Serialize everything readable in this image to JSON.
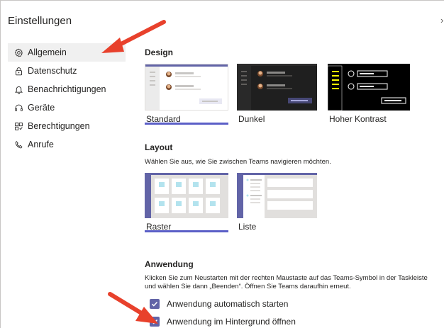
{
  "window": {
    "title": "Einstellungen",
    "close_glyph": "›"
  },
  "sidebar": {
    "items": [
      {
        "label": "Allgemein",
        "icon": "gear-icon",
        "active": true
      },
      {
        "label": "Datenschutz",
        "icon": "lock-icon",
        "active": false
      },
      {
        "label": "Benachrichtigungen",
        "icon": "bell-icon",
        "active": false
      },
      {
        "label": "Geräte",
        "icon": "headset-icon",
        "active": false
      },
      {
        "label": "Berechtigungen",
        "icon": "permissions-icon",
        "active": false
      },
      {
        "label": "Anrufe",
        "icon": "phone-icon",
        "active": false
      }
    ]
  },
  "design": {
    "title": "Design",
    "themes": [
      {
        "label": "Standard",
        "selected": true
      },
      {
        "label": "Dunkel",
        "selected": false
      },
      {
        "label": "Hoher Kontrast",
        "selected": false
      }
    ]
  },
  "layout": {
    "title": "Layout",
    "description": "Wählen Sie aus, wie Sie zwischen Teams navigieren möchten.",
    "options": [
      {
        "label": "Raster",
        "selected": true
      },
      {
        "label": "Liste",
        "selected": false
      }
    ]
  },
  "app": {
    "title": "Anwendung",
    "description": "Klicken Sie zum Neustarten mit der rechten Maustaste auf das Teams-Symbol in der Taskleiste und wählen Sie dann „Beenden“. Öffnen Sie Teams daraufhin erneut.",
    "options": [
      {
        "label": "Anwendung automatisch starten",
        "checked": true
      },
      {
        "label": "Anwendung im Hintergrund öffnen",
        "checked": true
      }
    ]
  },
  "colors": {
    "accent": "#6264a7",
    "annotation_arrow": "#e8412c"
  }
}
